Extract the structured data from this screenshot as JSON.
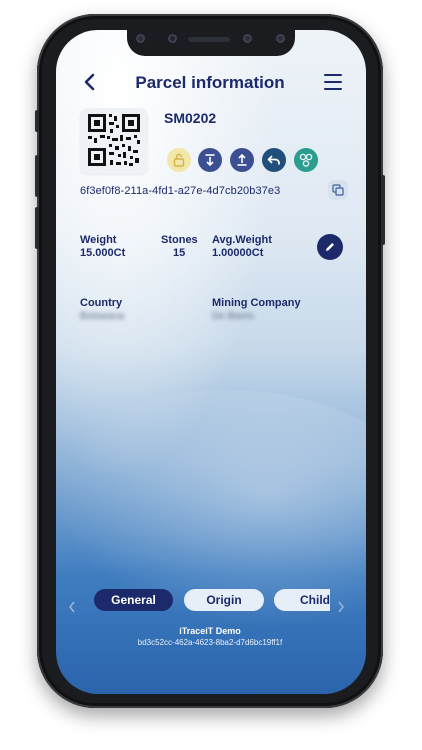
{
  "header": {
    "title": "Parcel information",
    "back_icon": "chevron-left-icon",
    "menu_icon": "hamburger-menu-icon"
  },
  "parcel": {
    "id": "SM0202",
    "hash": "6f3ef0f8-211a-4fd1-a27e-4d7cb20b37e3",
    "actions": [
      {
        "name": "lock-icon",
        "color": "#f2e7a8"
      },
      {
        "name": "download-icon",
        "color": "#3d4f93"
      },
      {
        "name": "upload-icon",
        "color": "#3d4f93"
      },
      {
        "name": "reply-icon",
        "color": "#1f4f7a"
      },
      {
        "name": "share-nodes-icon",
        "color": "#2a9d8f"
      }
    ]
  },
  "stats": {
    "weight_label": "Weight",
    "weight_value": "15.000Ct",
    "stones_label": "Stones",
    "stones_value": "15",
    "avg_label": "Avg.Weight",
    "avg_value": "1.00000Ct"
  },
  "origin": {
    "country_label": "Country",
    "country_value": "Botswana",
    "company_label": "Mining Company",
    "company_value": "De Beers"
  },
  "tabs": [
    {
      "label": "General",
      "active": true
    },
    {
      "label": "Origin",
      "active": false
    },
    {
      "label": "Child",
      "active": false
    }
  ],
  "footer": {
    "app_name": "iTraceiT Demo",
    "device_id": "bd3c52cc-462a-4623-8ba2-d7d6bc19ff1f"
  },
  "colors": {
    "primary": "#1c2a6b",
    "accent_teal": "#2a9d8f"
  }
}
